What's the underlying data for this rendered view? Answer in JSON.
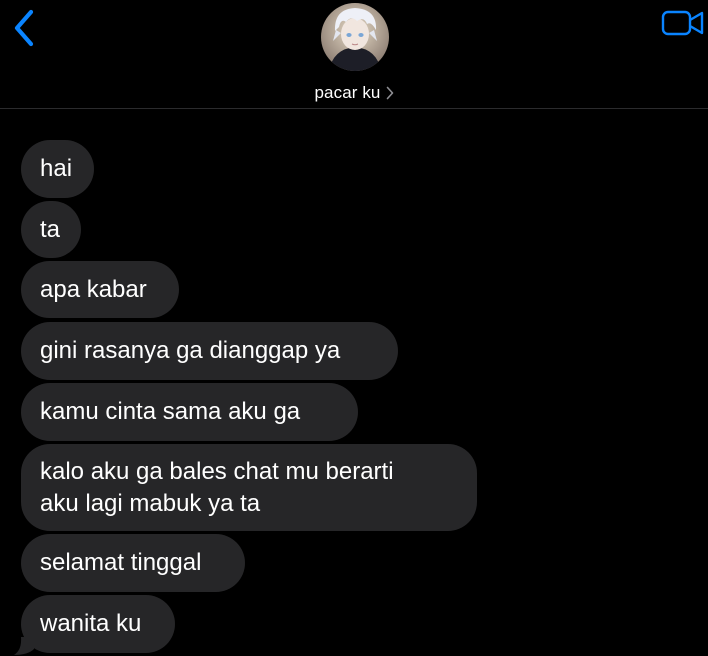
{
  "header": {
    "contact_name": "pacar ku",
    "accent_color": "#0a84ff",
    "back_icon": "chevron-left-icon",
    "video_icon": "video-camera-icon",
    "disclosure_icon": "chevron-right-icon"
  },
  "messages": [
    {
      "direction": "incoming",
      "lines": [
        "hai"
      ]
    },
    {
      "direction": "incoming",
      "lines": [
        "ta"
      ]
    },
    {
      "direction": "incoming",
      "lines": [
        "apa kabar"
      ]
    },
    {
      "direction": "incoming",
      "lines": [
        "gini rasanya ga dianggap ya"
      ]
    },
    {
      "direction": "incoming",
      "lines": [
        "kamu cinta sama aku ga"
      ]
    },
    {
      "direction": "incoming",
      "lines": [
        "kalo aku ga bales chat mu berarti",
        "aku lagi mabuk ya ta"
      ]
    },
    {
      "direction": "incoming",
      "lines": [
        "selamat tinggal"
      ]
    },
    {
      "direction": "incoming",
      "lines": [
        "wanita ku"
      ]
    }
  ],
  "theme": {
    "background": "#000000",
    "bubble_incoming": "#262628",
    "text": "#ffffff"
  }
}
